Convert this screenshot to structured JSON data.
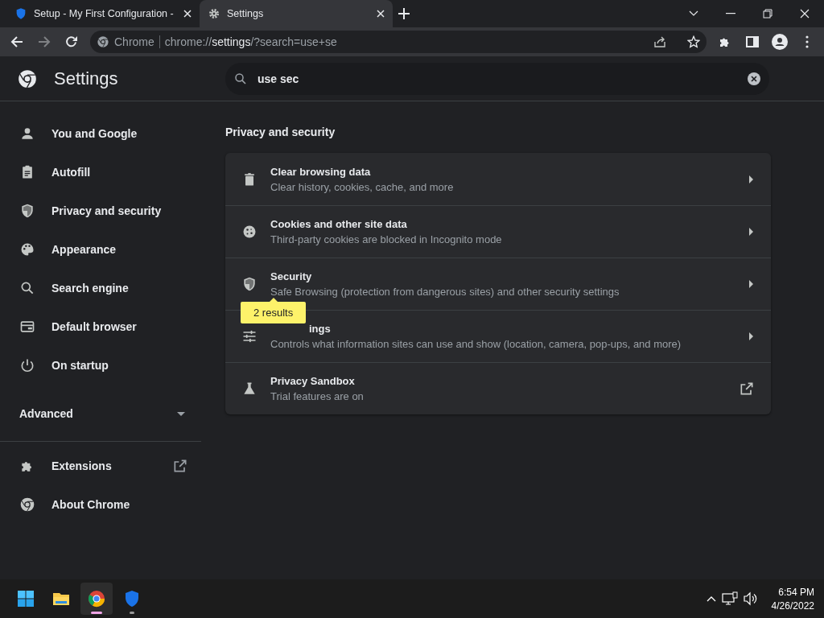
{
  "tabs": [
    {
      "title": "Setup - My First Configuration -",
      "selected": false
    },
    {
      "title": "Settings",
      "selected": true
    }
  ],
  "address_bar": {
    "site_label": "Chrome",
    "url_scheme": "chrome://",
    "url_host": "settings",
    "url_rest": "/?search=use+se"
  },
  "header": {
    "title": "Settings",
    "search_value": "use sec"
  },
  "sidebar": {
    "items": [
      {
        "label": "You and Google"
      },
      {
        "label": "Autofill"
      },
      {
        "label": "Privacy and security"
      },
      {
        "label": "Appearance"
      },
      {
        "label": "Search engine"
      },
      {
        "label": "Default browser"
      },
      {
        "label": "On startup"
      }
    ],
    "advanced": {
      "label": "Advanced",
      "expanded": false
    },
    "bottom_items": [
      {
        "label": "Extensions",
        "external": true
      },
      {
        "label": "About Chrome",
        "external": false
      }
    ]
  },
  "section": {
    "title": "Privacy and security",
    "rows": [
      {
        "title": "Clear browsing data",
        "subtitle": "Clear history, cookies, cache, and more",
        "kind": "link"
      },
      {
        "title": "Cookies and other site data",
        "subtitle": "Third-party cookies are blocked in Incognito mode",
        "kind": "link"
      },
      {
        "title": "Security",
        "subtitle": "Safe Browsing (protection from dangerous sites) and other security settings",
        "kind": "link"
      },
      {
        "title": "ings",
        "subtitle": "Controls what information sites can use and show (location, camera, pop-ups, and more)",
        "kind": "link",
        "search_bubble": "2 results"
      },
      {
        "title": "Privacy Sandbox",
        "subtitle": "Trial features are on",
        "kind": "external"
      }
    ]
  },
  "taskbar": {
    "apps": [
      {
        "active": false,
        "running": false
      },
      {
        "active": false,
        "running": false
      },
      {
        "active": true,
        "running": true
      },
      {
        "active": false,
        "running": true
      }
    ],
    "time": "6:54 PM",
    "date": "4/26/2022"
  }
}
